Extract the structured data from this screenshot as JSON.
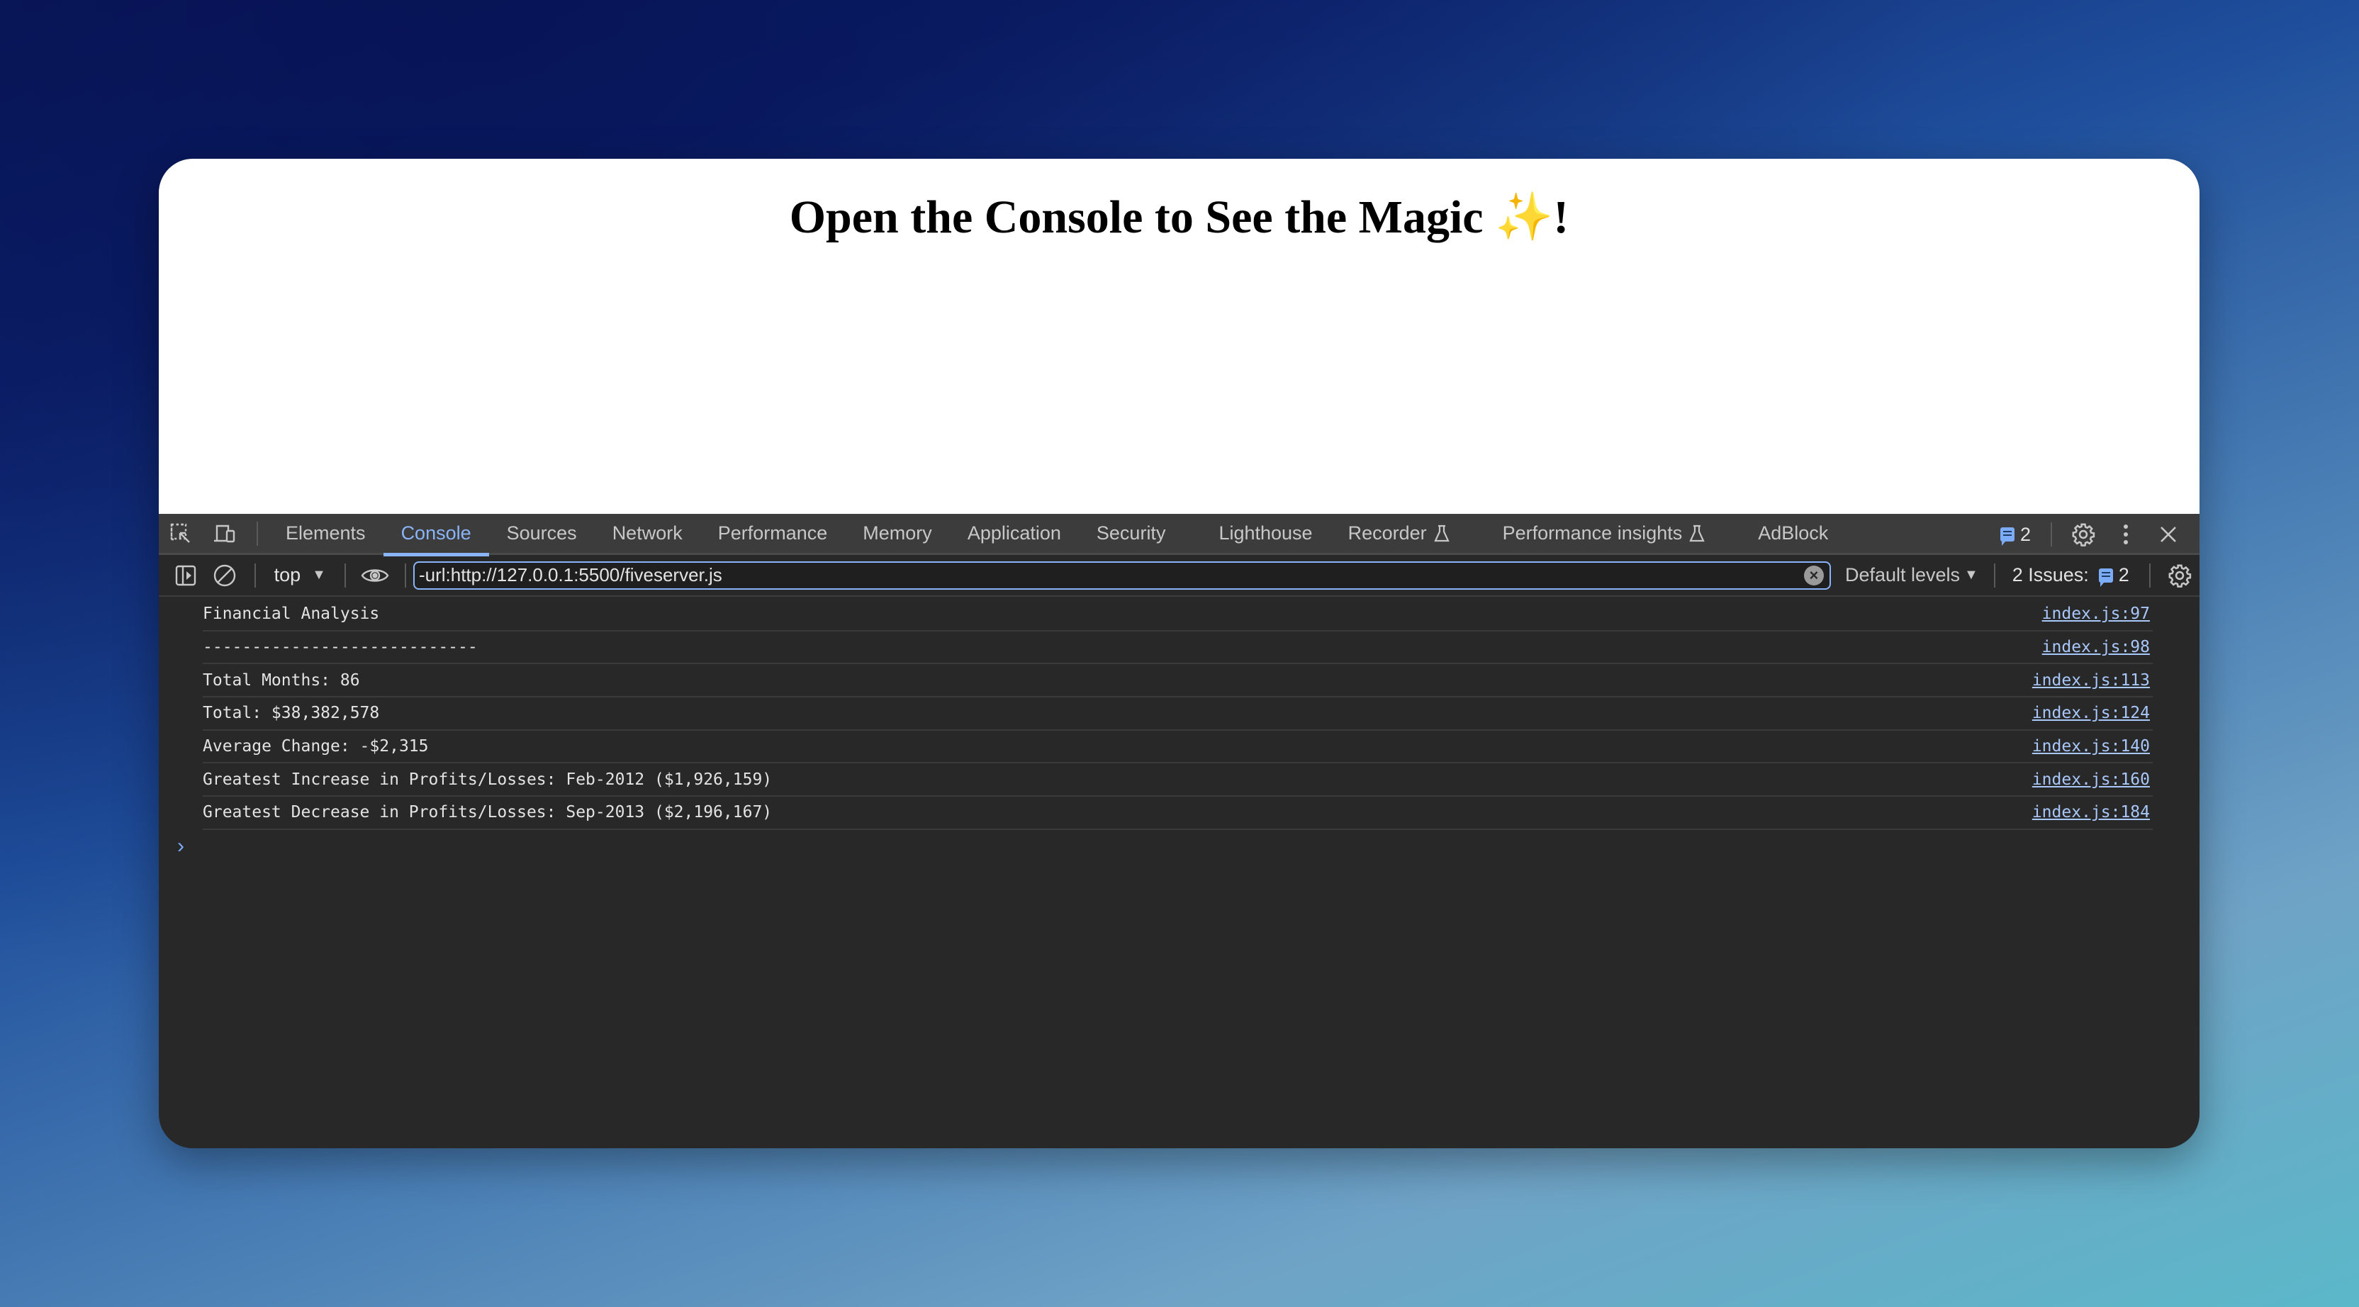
{
  "page": {
    "heading": "Open the Console to See the Magic ",
    "heading_emoji": "✨",
    "heading_suffix": "!"
  },
  "devtools": {
    "tabs": [
      {
        "label": "Elements",
        "active": false
      },
      {
        "label": "Console",
        "active": true
      },
      {
        "label": "Sources",
        "active": false
      },
      {
        "label": "Network",
        "active": false
      },
      {
        "label": "Performance",
        "active": false
      },
      {
        "label": "Memory",
        "active": false
      },
      {
        "label": "Application",
        "active": false
      },
      {
        "label": "Security",
        "active": false
      },
      {
        "label": "Lighthouse",
        "active": false
      },
      {
        "label": "Recorder",
        "active": false,
        "experimental": true
      },
      {
        "label": "Performance insights",
        "active": false,
        "experimental": true
      },
      {
        "label": "AdBlock",
        "active": false
      }
    ],
    "messages_count": "2",
    "flask_icon": "⚗",
    "filter_bar": {
      "context": "top",
      "filter_value": "-url:http://127.0.0.1:5500/fiveserver.js",
      "levels_label": "Default levels",
      "issues_label": "2 Issues:",
      "issues_count": "2"
    },
    "colors": {
      "accent": "#8ab4f8",
      "link": "#a8c7fa",
      "panel_bg": "#282828",
      "tabbar_bg": "#3c3c3c"
    }
  },
  "console": {
    "rows": [
      {
        "text": "Financial Analysis",
        "source": "index.js:97"
      },
      {
        "text": "----------------------------",
        "source": "index.js:98"
      },
      {
        "text": "Total Months: 86",
        "source": "index.js:113"
      },
      {
        "text": "Total: $38,382,578",
        "source": "index.js:124"
      },
      {
        "text": "Average Change: -$2,315",
        "source": "index.js:140"
      },
      {
        "text": "Greatest Increase in Profits/Losses: Feb-2012 ($1,926,159)",
        "source": "index.js:160"
      },
      {
        "text": "Greatest Decrease in Profits/Losses: Sep-2013 ($2,196,167)",
        "source": "index.js:184"
      }
    ],
    "prompt_symbol": "›"
  }
}
